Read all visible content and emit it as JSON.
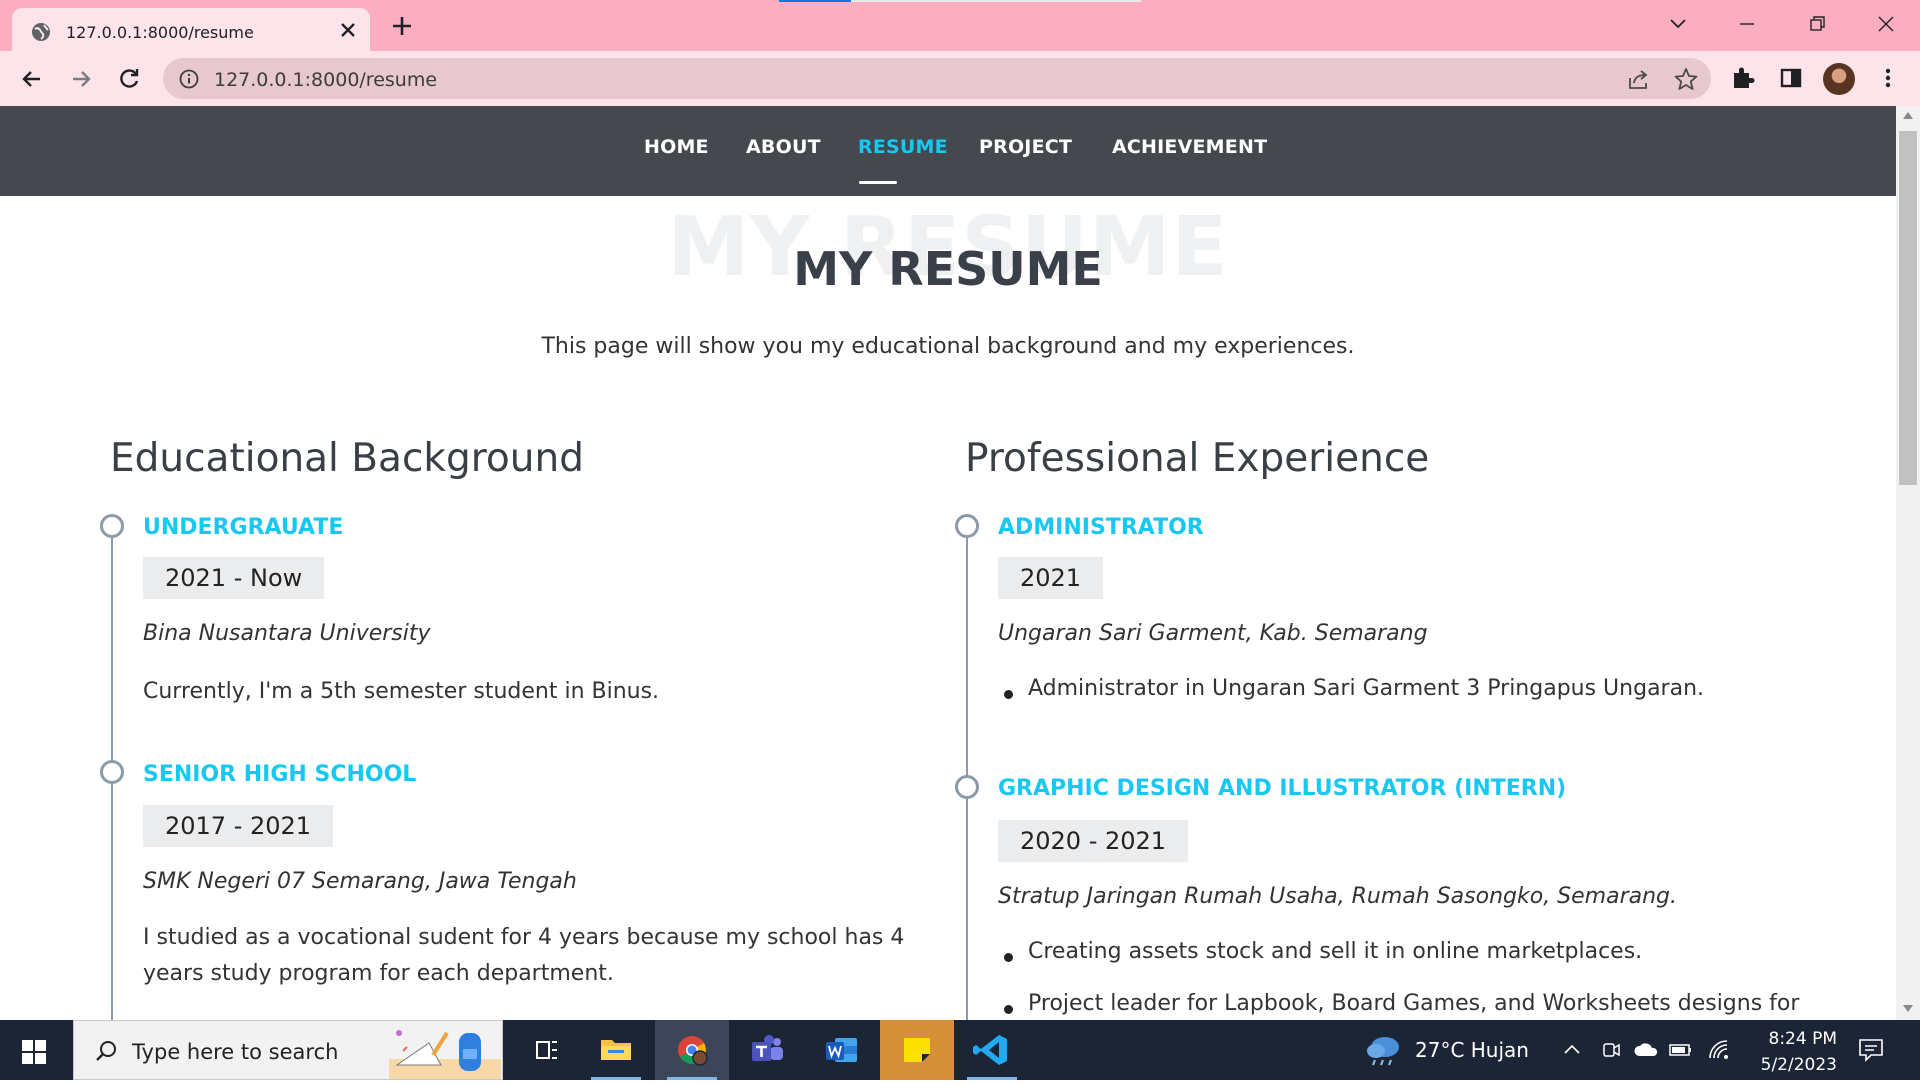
{
  "browser": {
    "tab_title": "127.0.0.1:8000/resume",
    "url": "127.0.0.1:8000/resume",
    "icons": [
      "globe-icon",
      "close-icon",
      "plus-icon",
      "chevron-down-icon",
      "minimize-icon",
      "restore-icon",
      "close-window-icon",
      "back-arrow-icon",
      "forward-arrow-icon",
      "reload-icon",
      "info-icon",
      "share-icon",
      "star-icon",
      "extensions-icon",
      "sidepanel-icon",
      "avatar"
    ]
  },
  "nav": {
    "items": [
      "HOME",
      "ABOUT",
      "RESUME",
      "PROJECT",
      "ACHIEVEMENT"
    ],
    "active": "RESUME",
    "accent_color": "#18c8f3",
    "bg_color": "#45484e"
  },
  "hero": {
    "bg_title": "MY RESUME",
    "title": "MY RESUME",
    "subtitle": "This page will show you my educational background and my experiences."
  },
  "education": {
    "title": "Educational Background",
    "items": [
      {
        "title": "UNDERGRAUATE",
        "date": "2021 - Now",
        "place": "Bina Nusantara University",
        "desc": "Currently, I'm a 5th semester student in Binus."
      },
      {
        "title": "SENIOR HIGH SCHOOL",
        "date": "2017 - 2021",
        "place": "SMK Negeri 07 Semarang, Jawa Tengah",
        "desc": "I studied as a vocational sudent for 4 years because my school has 4 years study program for each department."
      }
    ]
  },
  "experience": {
    "title": "Professional Experience",
    "items": [
      {
        "title": "ADMINISTRATOR",
        "date": "2021",
        "place": "Ungaran Sari Garment, Kab. Semarang",
        "bullets": [
          "Administrator in Ungaran Sari Garment 3 Pringapus Ungaran."
        ]
      },
      {
        "title": "GRAPHIC DESIGN AND ILLUSTRATOR (INTERN)",
        "date": "2020 - 2021",
        "place": "Stratup Jaringan Rumah Usaha, Rumah Sasongko, Semarang.",
        "bullets": [
          "Creating assets stock and sell it in online marketplaces.",
          "Project leader for Lapbook, Board Games, and Worksheets designs for"
        ]
      }
    ]
  },
  "taskbar": {
    "search_placeholder": "Type here to search",
    "weather": "27°C  Hujan",
    "time": "8:24 PM",
    "date": "5/2/2023",
    "apps": [
      "task-view-icon",
      "file-explorer-icon",
      "chrome-icon",
      "teams-icon",
      "word-icon",
      "sticky-notes-icon",
      "vscode-icon"
    ]
  }
}
